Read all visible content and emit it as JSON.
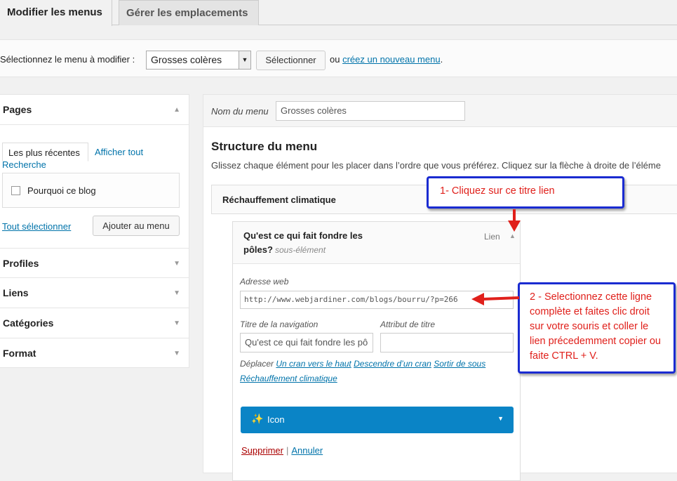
{
  "tabs": {
    "edit": "Modifier les menus",
    "locations": "Gérer les emplacements"
  },
  "select_bar": {
    "label": "Sélectionnez le menu à modifier :",
    "selected": "Grosses colères",
    "button": "Sélectionner",
    "or": "ou",
    "create_link": "créez un nouveau menu",
    "period": "."
  },
  "left": {
    "pages": "Pages",
    "tab_recent": "Les plus récentes",
    "tab_all": "Afficher tout",
    "tab_search": "Recherche",
    "item": "Pourquoi ce blog",
    "select_all": "Tout sélectionner",
    "add_button": "Ajouter au menu",
    "sections": [
      "Profiles",
      "Liens",
      "Catégories",
      "Format"
    ]
  },
  "right": {
    "name_label": "Nom du menu",
    "name_value": "Grosses colères",
    "structure_title": "Structure du menu",
    "structure_desc": "Glissez chaque élément pour les placer dans l’ordre que vous préférez. Cliquez sur la flèche à droite de l’éléme",
    "item_title": "Réchauffement climatique",
    "sub_title_1": "Qu'est ce qui fait fondre les",
    "sub_title_2": "pôles?",
    "sub_sub": "sous-élément",
    "sub_type": "Lien",
    "url_label": "Adresse web",
    "url_value": "http://www.webjardiner.com/blogs/bourru/?p=266",
    "nav_label": "Titre de la navigation",
    "nav_value": "Qu'est ce qui fait fondre les pô",
    "attr_label": "Attribut de titre",
    "move_label": "Déplacer",
    "move_up": "Un cran vers le haut",
    "move_down": "Descendre d’un cran",
    "move_out": "Sortir de sous",
    "move_parent": "Réchauffement climatique",
    "icon_button": "Icon",
    "delete": "Supprimer",
    "sep": "|",
    "cancel": "Annuler"
  },
  "notes": {
    "note1": "1- Cliquez sur ce titre lien",
    "note2": "2 - Selectionnez cette ligne complète et faites clic droit sur votre souris et coller le lien précedemment copier ou faite CTRL + V."
  },
  "colors": {
    "link": "#0073aa",
    "button_blue": "#0a84c6",
    "annotation_border": "#1a2bd1",
    "annotation_text": "#e0201b",
    "delete": "#aa0000"
  },
  "icons": [
    "caret-up-icon",
    "caret-down-icon",
    "select-arrow-icon",
    "checkbox-icon",
    "wand-icon",
    "dropdown-icon",
    "red-arrow-icon"
  ]
}
